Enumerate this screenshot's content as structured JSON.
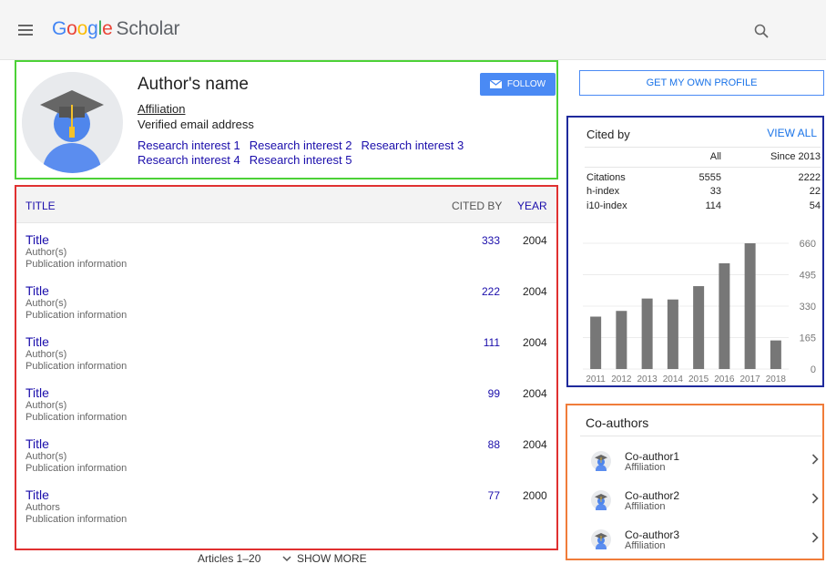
{
  "header": {
    "logo_parts": [
      "G",
      "o",
      "o",
      "g",
      "l",
      "e"
    ],
    "logo_scholar": "Scholar",
    "menu_icon": "hamburger-menu-icon",
    "search_icon": "search-icon"
  },
  "profile": {
    "name": "Author's name",
    "affiliation": "Affiliation",
    "email": "Verified email address",
    "interests": [
      "Research interest 1",
      "Research interest 2",
      "Research interest 3",
      "Research interest 4",
      "Research interest 5"
    ],
    "follow_label": "FOLLOW",
    "follow_icon": "mail-icon",
    "avatar_icon": "graduate-avatar-icon",
    "border_color": "#4cd137"
  },
  "publications": {
    "columns": {
      "title": "TITLE",
      "cited_by": "CITED BY",
      "year": "YEAR"
    },
    "rows": [
      {
        "title": "Title",
        "authors": "Author(s)",
        "info": "Publication information",
        "cited_by": "333",
        "year": "2004"
      },
      {
        "title": "Title",
        "authors": "Author(s)",
        "info": "Publication information",
        "cited_by": "222",
        "year": "2004"
      },
      {
        "title": "Title",
        "authors": "Author(s)",
        "info": "Publication information",
        "cited_by": "111",
        "year": "2004"
      },
      {
        "title": "Title",
        "authors": "Author(s)",
        "info": "Publication information",
        "cited_by": "99",
        "year": "2004"
      },
      {
        "title": "Title",
        "authors": "Author(s)",
        "info": "Publication information",
        "cited_by": "88",
        "year": "2004"
      },
      {
        "title": "Title",
        "authors": "Authors",
        "info": "Publication information",
        "cited_by": "77",
        "year": "2000"
      }
    ],
    "articles_range": "Articles 1–20",
    "show_more": "SHOW MORE",
    "border_color": "#e03131"
  },
  "own_profile_button": "GET MY OWN PROFILE",
  "cited_by": {
    "title": "Cited by",
    "view_all": "VIEW ALL",
    "col_all": "All",
    "col_since": "Since 2013",
    "metrics": [
      {
        "label": "Citations",
        "all": "5555",
        "since": "2222"
      },
      {
        "label": "h-index",
        "all": "33",
        "since": "22"
      },
      {
        "label": "i10-index",
        "all": "114",
        "since": "54"
      }
    ],
    "border_color": "#1f2a9c"
  },
  "chart_data": {
    "type": "bar",
    "categories": [
      "2011",
      "2012",
      "2013",
      "2014",
      "2015",
      "2016",
      "2017",
      "2018"
    ],
    "values": [
      275,
      305,
      370,
      365,
      435,
      555,
      660,
      150
    ],
    "yticks": [
      "0",
      "165",
      "330",
      "495",
      "660"
    ],
    "ylim": [
      0,
      660
    ],
    "bar_color": "#777777",
    "grid": true
  },
  "coauthors": {
    "title": "Co-authors",
    "items": [
      {
        "name": "Co-author1",
        "affiliation": "Affiliation"
      },
      {
        "name": "Co-author2",
        "affiliation": "Affiliation"
      },
      {
        "name": "Co-author3",
        "affiliation": "Affiliation"
      }
    ],
    "border_color": "#f07c3a"
  }
}
